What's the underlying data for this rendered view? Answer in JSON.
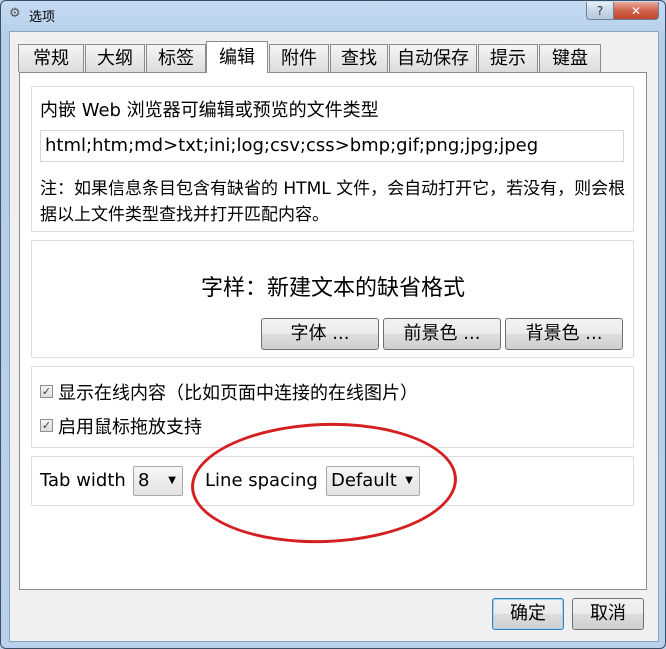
{
  "window": {
    "title": "选项",
    "help_label": "?",
    "close_label": "✕"
  },
  "tabs": [
    {
      "label": "常规"
    },
    {
      "label": "大纲"
    },
    {
      "label": "标签"
    },
    {
      "label": "编辑"
    },
    {
      "label": "附件"
    },
    {
      "label": "查找"
    },
    {
      "label": "自动保存"
    },
    {
      "label": "提示"
    },
    {
      "label": "键盘"
    }
  ],
  "active_tab": "编辑",
  "editor": {
    "file_types_label": "内嵌 Web 浏览器可编辑或预览的文件类型",
    "file_types_value": "html;htm;md>txt;ini;log;csv;css>bmp;gif;png;jpg;jpeg",
    "note": "注：如果信息条目包含有缺省的 HTML 文件，会自动打开它，若没有，则会根据以上文件类型查找并打开匹配内容。"
  },
  "style": {
    "heading": "字样：新建文本的缺省格式",
    "font_button": "字体 ...",
    "foreground_button": "前景色 ...",
    "background_button": "背景色 ..."
  },
  "options": {
    "show_online": {
      "label": "显示在线内容（比如页面中连接的在线图片）",
      "checked": true
    },
    "drag_drop": {
      "label": "启用鼠标拖放支持",
      "checked": true
    }
  },
  "spacing": {
    "tab_width_label": "Tab width",
    "tab_width_value": "8",
    "line_spacing_label": "Line spacing",
    "line_spacing_value": "Default"
  },
  "footer": {
    "ok_label": "确定",
    "cancel_label": "取消"
  },
  "icons": {
    "app": "gear-icon",
    "dropdown": "chevron-down-icon",
    "check": "checkmark-icon"
  },
  "colors": {
    "highlight_ellipse": "#d42020",
    "default_button_border": "#3c7fb1"
  }
}
